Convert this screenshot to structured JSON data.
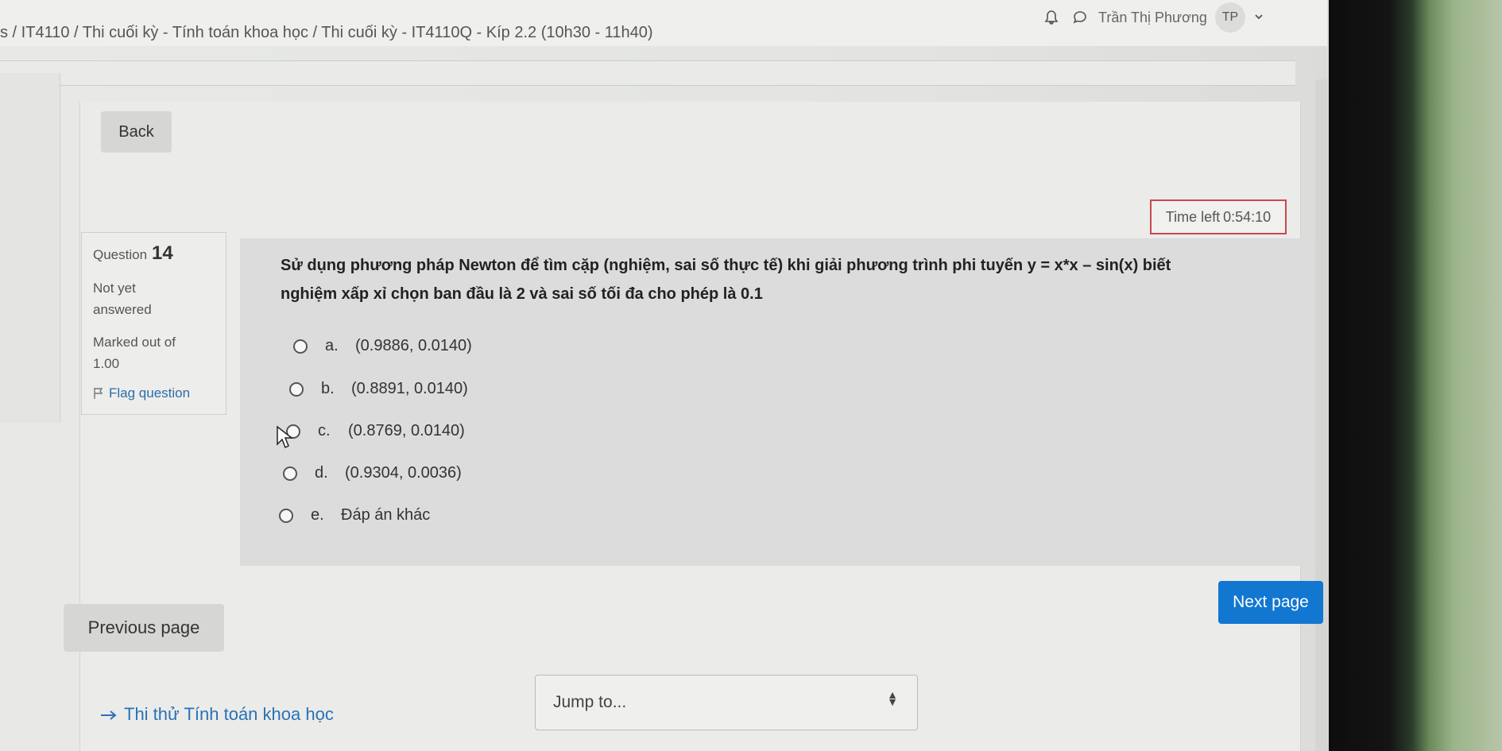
{
  "header": {
    "breadcrumb": "s / IT4110 / Thi cuối kỳ - Tính toán khoa học / Thi cuối kỳ - IT4110Q - Kíp 2.2 (10h30 - 11h40)",
    "user_name": "Trần Thị Phương",
    "avatar_initials": "TP"
  },
  "nav": {
    "back_label": "Back"
  },
  "timer": {
    "label": "Time left",
    "value": "0:54:10"
  },
  "question_info": {
    "question_label": "Question",
    "question_number": "14",
    "state_line1": "Not yet",
    "state_line2": "answered",
    "grade_line1": "Marked out of",
    "grade_line2": "1.00",
    "flag_label": "Flag question"
  },
  "question": {
    "text_line1": "Sử dụng phương pháp Newton để tìm cặp (nghiệm, sai số thực tế) khi giải phương trình phi tuyến y = x*x – sin(x) biết",
    "text_line2": "nghiệm xấp xỉ chọn ban đầu là 2 và sai số tối đa cho phép là 0.1",
    "answers": [
      {
        "letter": "a.",
        "text": "(0.9886, 0.0140)"
      },
      {
        "letter": "b.",
        "text": "(0.8891, 0.0140)"
      },
      {
        "letter": "c.",
        "text": "(0.8769, 0.0140)"
      },
      {
        "letter": "d.",
        "text": "(0.9304, 0.0036)"
      },
      {
        "letter": "e.",
        "text": "Đáp án khác"
      }
    ]
  },
  "navigation": {
    "next_label": "Next page",
    "prev_label": "Previous page",
    "course_link": "Thi thử Tính toán khoa học",
    "jump_label": "Jump to..."
  },
  "colors": {
    "primary": "#1177d1",
    "timer_border": "#c9474d",
    "link": "#2a72b5"
  }
}
